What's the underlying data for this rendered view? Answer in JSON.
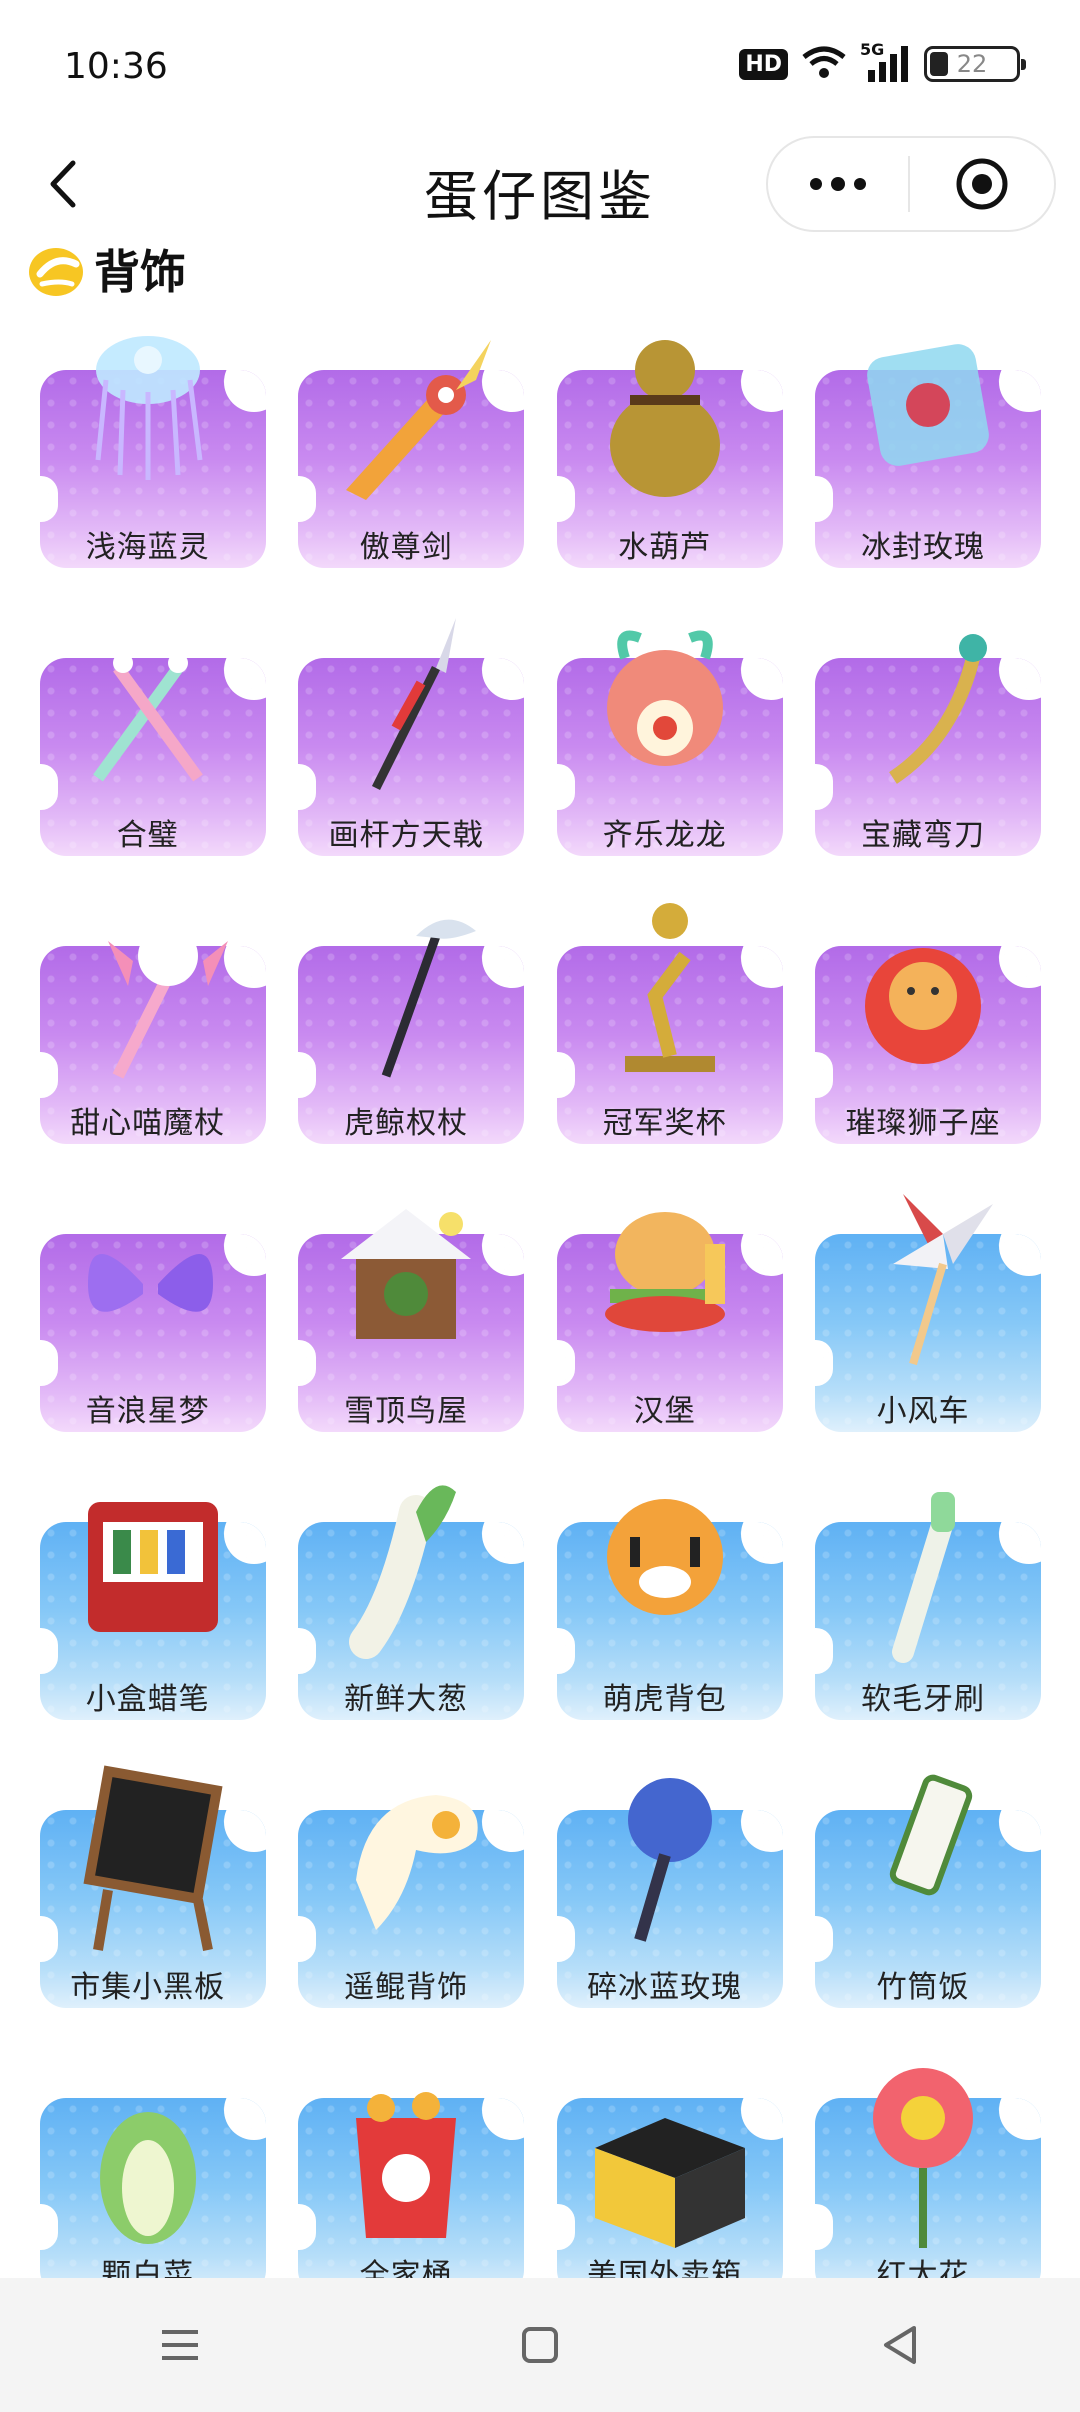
{
  "status": {
    "time": "10:36",
    "hd": "HD",
    "network": "5G",
    "battery": "22"
  },
  "nav": {
    "title": "蛋仔图鉴"
  },
  "section": {
    "title": "背饰"
  },
  "items": [
    {
      "name": "浅海蓝灵",
      "theme": "purple",
      "icon": "jellyfish-icon"
    },
    {
      "name": "傲尊剑",
      "theme": "purple",
      "icon": "sword-icon"
    },
    {
      "name": "水葫芦",
      "theme": "purple",
      "icon": "gourd-icon"
    },
    {
      "name": "冰封玫瑰",
      "theme": "purple",
      "icon": "ice-rose-icon"
    },
    {
      "name": "合璧",
      "theme": "purple",
      "icon": "twin-swords-icon"
    },
    {
      "name": "画杆方天戟",
      "theme": "purple",
      "icon": "halberd-icon"
    },
    {
      "name": "齐乐龙龙",
      "theme": "purple",
      "icon": "dragon-icon"
    },
    {
      "name": "宝藏弯刀",
      "theme": "purple",
      "icon": "scimitar-icon"
    },
    {
      "name": "甜心喵魔杖",
      "theme": "purple",
      "icon": "cat-wand-icon"
    },
    {
      "name": "虎鲸权杖",
      "theme": "purple",
      "icon": "orca-scepter-icon"
    },
    {
      "name": "冠军奖杯",
      "theme": "purple",
      "icon": "trophy-icon"
    },
    {
      "name": "璀璨狮子座",
      "theme": "purple",
      "icon": "lion-icon"
    },
    {
      "name": "音浪星梦",
      "theme": "purple",
      "icon": "wings-icon"
    },
    {
      "name": "雪顶鸟屋",
      "theme": "purple",
      "icon": "birdhouse-icon"
    },
    {
      "name": "汉堡",
      "theme": "purple",
      "icon": "burger-icon"
    },
    {
      "name": "小风车",
      "theme": "blue",
      "icon": "pinwheel-icon"
    },
    {
      "name": "小盒蜡笔",
      "theme": "blue",
      "icon": "crayon-box-icon"
    },
    {
      "name": "新鲜大葱",
      "theme": "blue",
      "icon": "leek-icon"
    },
    {
      "name": "萌虎背包",
      "theme": "blue",
      "icon": "tiger-bag-icon"
    },
    {
      "name": "软毛牙刷",
      "theme": "blue",
      "icon": "toothbrush-icon"
    },
    {
      "name": "市集小黑板",
      "theme": "blue",
      "icon": "blackboard-icon"
    },
    {
      "name": "遥鲲背饰",
      "theme": "blue",
      "icon": "kun-icon"
    },
    {
      "name": "碎冰蓝玫瑰",
      "theme": "blue",
      "icon": "blue-rose-icon"
    },
    {
      "name": "竹筒饭",
      "theme": "blue",
      "icon": "bamboo-rice-icon"
    },
    {
      "name": "颗白菜",
      "theme": "blue",
      "icon": "cabbage-icon"
    },
    {
      "name": "全家桶",
      "theme": "blue",
      "icon": "bucket-icon"
    },
    {
      "name": "美国外卖箱",
      "theme": "blue",
      "icon": "delivery-box-icon"
    },
    {
      "name": "红太花",
      "theme": "blue",
      "icon": "flower-icon"
    }
  ],
  "colors": {
    "purple_top": "#b26be8",
    "blue_top": "#5fb1f4",
    "section_icon": "#f5c518"
  }
}
